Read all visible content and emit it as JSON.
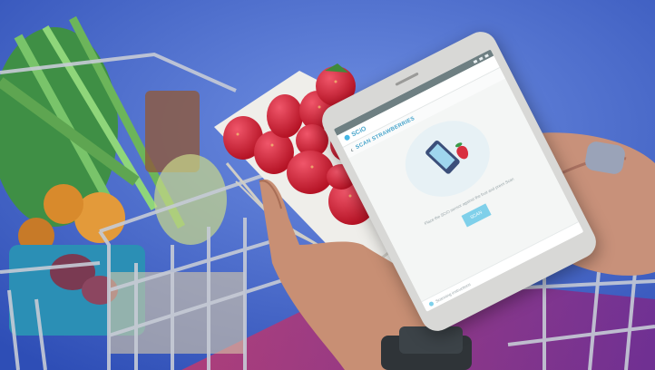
{
  "app": {
    "brand": "SCiO",
    "screen_title": "SCAN STRAWBERRIES",
    "instruction": "Place the SCiO sensor against the fruit and press Scan",
    "scan_button": "SCAN",
    "footer_text": "Scanning instructions"
  },
  "icons": {
    "logo": "scio-logo-icon",
    "back": "back-arrow-icon",
    "help": "help-icon"
  },
  "colors": {
    "background": "#3e63c9",
    "accent": "#47b7e5",
    "strawberry": "#d42b3a"
  }
}
